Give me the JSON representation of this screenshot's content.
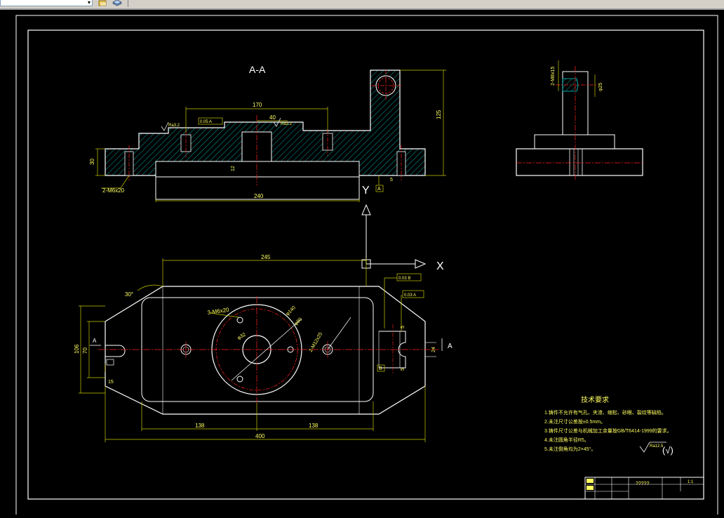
{
  "toolbar": {
    "layer_combo_value": "",
    "icons": [
      "layer-state-icon",
      "layer-stack-icon"
    ]
  },
  "colors": {
    "background": "#000000",
    "outline": "#ffffff",
    "dimension": "#ffff00",
    "centerline": "#ff2020",
    "hatch": "#00ffff",
    "hidden": "#ff2020"
  },
  "drawing": {
    "section_title": "A-A",
    "top_view": {
      "dims": {
        "d170": "170",
        "d40": "40",
        "d240": "240",
        "d125": "125",
        "d30": "30",
        "d12": "12",
        "d5": "5",
        "ref_a": "A",
        "m6": "2-M6x20",
        "flat": "0.05 A",
        "rough1": "Ra3.2",
        "rough2": "Ra3.2"
      }
    },
    "side_view": {
      "thread": "2-M8x15",
      "dia": "φ25"
    },
    "plan_view": {
      "dims": {
        "d245": "245",
        "d30deg": "30°",
        "d106": "106",
        "d70": "70",
        "d15": "15",
        "d138a": "138",
        "d138b": "138",
        "d400": "400",
        "holes_m6": "3-M6x20",
        "holes_m12": "2-M12x25",
        "phi_center": "φ32",
        "phi_outer": "φ140",
        "phi_pitch": "φ80",
        "d24": "24",
        "d5a": "5",
        "d5b": "5",
        "tol1": "0.03 B",
        "tol2": "0.03 A",
        "ref_b": "B",
        "ref_a_right": "A",
        "ref_a_left": "A"
      },
      "axis_x": "X",
      "axis_y": "Y"
    },
    "tech_requirements": {
      "title": "技术要求",
      "items": [
        "1.铸件不允许有气孔、夹渣、缩松、砂眼、裂纹等缺陷。",
        "2.未注尺寸公差按±0.5mm。",
        "3.铸件尺寸公差与机械加工余量按GB/T6414-1999的要求。",
        "4.未注圆角半径R5。",
        "5.未注倒角均为2×45°。"
      ],
      "roughness_note": "Ra12.5",
      "roughness_tail": "(√)"
    },
    "title_block": {
      "name": "?????",
      "scale": "1:1"
    }
  }
}
